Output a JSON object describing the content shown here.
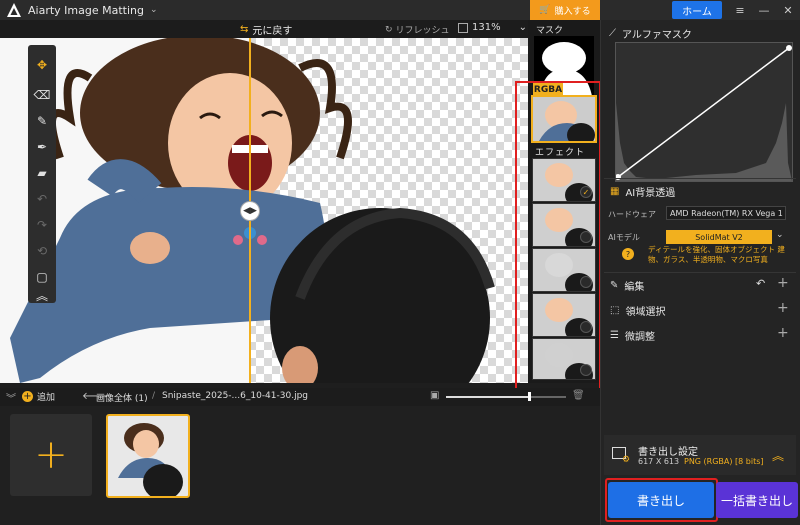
{
  "titlebar": {
    "app_title": "Aiarty Image Matting",
    "buy_label": "購入する",
    "home_label": "ホーム"
  },
  "viewbar": {
    "back_label": "元に戻す",
    "refresh_label": "リフレッシュ",
    "zoom": "131%"
  },
  "mask_panel": {
    "mask_label": "マスク",
    "rgba_label": "RGBA",
    "effect_label": "エフェクト"
  },
  "right_panel": {
    "alpha_mask_title": "アルファマスク",
    "ai_bg_title": "AI背景透過",
    "hardware_label": "ハードウェア",
    "hardware_value": "AMD Radeon(TM) RX Vega 1",
    "model_label": "AIモデル",
    "model_value": "SolidMat  V2",
    "model_note": "ディテールを強化、固体オブジェクト 建物、ガラス、半透明物、マクロ写真",
    "edit_title": "編集",
    "region_title": "領域選択",
    "fine_title": "微調整",
    "export_settings_title": "書き出し設定",
    "export_dims": "617 X 613",
    "export_format": "PNG (RGBA) [8 bits]",
    "export_button": "書き出し",
    "batch_button": "一括書き出し"
  },
  "bottom": {
    "add_label": "追加",
    "all_images_label": "画像全体 (1)",
    "separator": "/",
    "file_name": "Snipaste_2025-...6_10-41-30.jpg"
  },
  "colors": {
    "accent": "#f2b01e",
    "primary_blue": "#1e6fe6",
    "batch_purple": "#5a33d6",
    "highlight_red": "#e02020"
  }
}
